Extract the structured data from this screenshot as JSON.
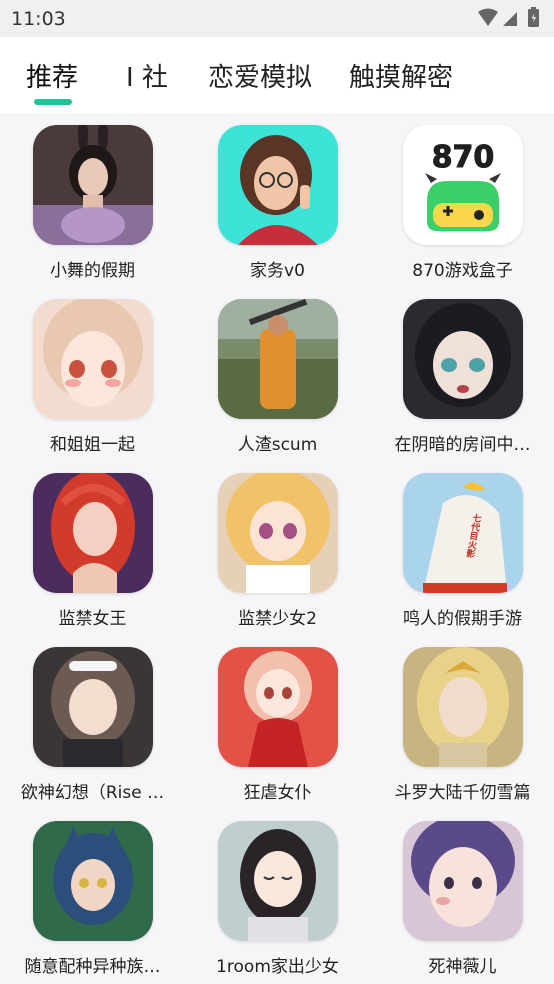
{
  "status_bar": {
    "time": "11:03"
  },
  "tabs": [
    {
      "label": "推荐",
      "active": true
    },
    {
      "label": "I 社",
      "active": false
    },
    {
      "label": "恋爱模拟",
      "active": false
    },
    {
      "label": "触摸解密",
      "active": false
    }
  ],
  "accent_color": "#1fc29b",
  "apps": [
    {
      "name": "小舞的假期",
      "icon": "bunny-girl-portrait-icon"
    },
    {
      "name": "家务v0",
      "icon": "glasses-girl-portrait-icon"
    },
    {
      "name": "870游戏盒子",
      "icon": "frog-gamepad-logo-icon",
      "logo_text": "870"
    },
    {
      "name": "和姐姐一起",
      "icon": "blonde-girl-portrait-icon"
    },
    {
      "name": "人渣scum",
      "icon": "soldier-orange-jumpsuit-icon"
    },
    {
      "name": "在阴暗的房间中…",
      "icon": "dark-haired-girl-portrait-icon"
    },
    {
      "name": "监禁女王",
      "icon": "red-haired-queen-portrait-icon"
    },
    {
      "name": "监禁少女2",
      "icon": "blonde-anime-girl-portrait-icon"
    },
    {
      "name": "鸣人的假期手游",
      "icon": "hokage-cloak-icon",
      "logo_text": "七代目火影"
    },
    {
      "name": "欲神幻想（Rise …",
      "icon": "maid-girl-portrait-icon"
    },
    {
      "name": "狂虐女仆",
      "icon": "red-dress-girl-portrait-icon"
    },
    {
      "name": "斗罗大陆千仞雪篇",
      "icon": "golden-haired-goddess-portrait-icon"
    },
    {
      "name": "随意配种异种族…",
      "icon": "wolf-girl-portrait-icon"
    },
    {
      "name": "1room家出少女",
      "icon": "black-haired-schoolgirl-portrait-icon"
    },
    {
      "name": "死神薇儿",
      "icon": "purple-haired-girl-portrait-icon"
    }
  ]
}
